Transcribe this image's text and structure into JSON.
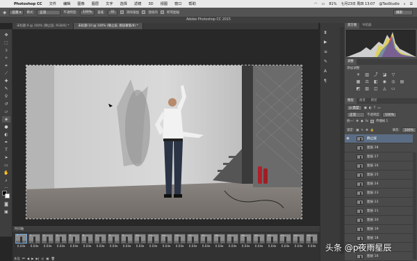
{
  "menubar": {
    "app_name": "Photoshop CC",
    "items": [
      "文件",
      "编辑",
      "图像",
      "图层",
      "文字",
      "选择",
      "滤镜",
      "3D",
      "视图",
      "窗口",
      "帮助"
    ],
    "battery": "81%",
    "datetime": "七月23日 周四 13:07",
    "user": "@TaoStudio"
  },
  "options": {
    "mode_label": "模式:",
    "mode_value": "正常",
    "opacity_label": "不透明度:",
    "opacity_value": "100%",
    "tolerance_label": "容差:",
    "tolerance_value": "32",
    "antialias_label": "消除锯齿",
    "contiguous_label": "连续的",
    "all_layers_label": "所有图层",
    "workspace_value": "摄影"
  },
  "window_title": "Adobe Photoshop CC 2015",
  "doc_tabs": [
    {
      "label": "未标题-9 @ 100% (静止层, RGB/8) *"
    },
    {
      "label": "未标题-10 @ 100% (静止层, 图层蒙版/8) *"
    }
  ],
  "panels": {
    "histogram_tab": "直方图",
    "navigator_tab": "导航器",
    "adjustments_tab": "调整",
    "adjustments_add": "添加调整",
    "layers_tab": "图层",
    "channels_tab": "通道",
    "paths_tab": "路径",
    "kind_label": "p 类型",
    "blend_mode": "正常",
    "opacity_label": "不透明度:",
    "opacity_value": "100%",
    "unify_label": "统一:",
    "propagate_label": "传播帧 1",
    "lock_label": "锁定:",
    "fill_label": "填充:",
    "fill_value": "100%"
  },
  "layers": [
    {
      "name": "静止层",
      "selected": true
    },
    {
      "name": "图层 28"
    },
    {
      "name": "图层 27"
    },
    {
      "name": "图层 26"
    },
    {
      "name": "图层 25"
    },
    {
      "name": "图层 24"
    },
    {
      "name": "图层 23"
    },
    {
      "name": "图层 22"
    },
    {
      "name": "图层 21"
    },
    {
      "name": "图层 20"
    },
    {
      "name": "图层 19"
    },
    {
      "name": "图层 18"
    },
    {
      "name": "图层 17"
    },
    {
      "name": "图层 16"
    }
  ],
  "timeline": {
    "title": "时间轴",
    "loop_label": "永远",
    "frames": [
      {
        "num": "1",
        "duration": "0.04▾"
      },
      {
        "num": "2",
        "duration": "0.04▾"
      },
      {
        "num": "3",
        "duration": "0.04▾"
      },
      {
        "num": "4",
        "duration": "0.04▾"
      },
      {
        "num": "5",
        "duration": "0.04▾"
      },
      {
        "num": "6",
        "duration": "0.04▾"
      },
      {
        "num": "7",
        "duration": "0.04▾"
      },
      {
        "num": "8",
        "duration": "0.04▾"
      },
      {
        "num": "9",
        "duration": "0.04▾"
      },
      {
        "num": "10",
        "duration": "0.04▾"
      },
      {
        "num": "11",
        "duration": "0.04▾"
      },
      {
        "num": "12",
        "duration": "0.04▾"
      },
      {
        "num": "13",
        "duration": "0.04▾"
      },
      {
        "num": "14",
        "duration": "0.04▾"
      },
      {
        "num": "15",
        "duration": "0.04▾"
      },
      {
        "num": "16",
        "duration": "0.04▾"
      },
      {
        "num": "17",
        "duration": "0.04▾"
      },
      {
        "num": "18",
        "duration": "0.04▾"
      },
      {
        "num": "19",
        "duration": "0.04▾"
      },
      {
        "num": "20",
        "duration": "0.04▾"
      },
      {
        "num": "21",
        "duration": "0.04▾"
      },
      {
        "num": "22",
        "duration": "0.04▾"
      },
      {
        "num": "23",
        "duration": "0.04▾"
      }
    ]
  },
  "watermark": "头条 @p夜雨星辰",
  "colors": {
    "selection": "#5b6d84",
    "ui_dark": "#262626",
    "panel": "#4a4a4a"
  }
}
